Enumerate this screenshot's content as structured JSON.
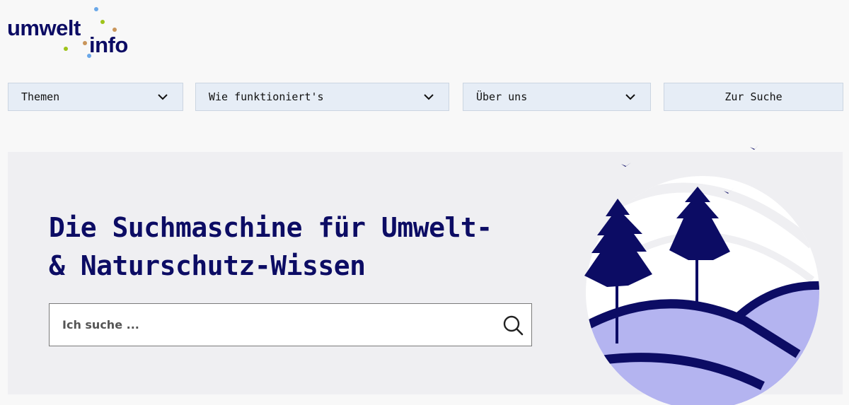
{
  "logo": {
    "word1": "umwelt",
    "word2": "info",
    "dot_colors": [
      "#6aa8e8",
      "#9ec31a",
      "#c9955a"
    ]
  },
  "nav": {
    "items": [
      {
        "label": "Themen",
        "icon": "chevron-down-icon"
      },
      {
        "label": "Wie funktioniert's",
        "icon": "chevron-down-icon"
      },
      {
        "label": "Über uns",
        "icon": "chevron-down-icon"
      },
      {
        "label": "Zur Suche"
      }
    ]
  },
  "hero": {
    "title_line1": "Die Suchmaschine für Umwelt-",
    "title_line2": "& Naturschutz-Wissen",
    "search_placeholder": "Ich suche ...",
    "search_icon": "search-icon"
  },
  "colors": {
    "brand": "#0c0c64",
    "hills": "#b4b4f0",
    "nav_bg": "#e6edf6",
    "hero_bg": "#efeff2"
  }
}
